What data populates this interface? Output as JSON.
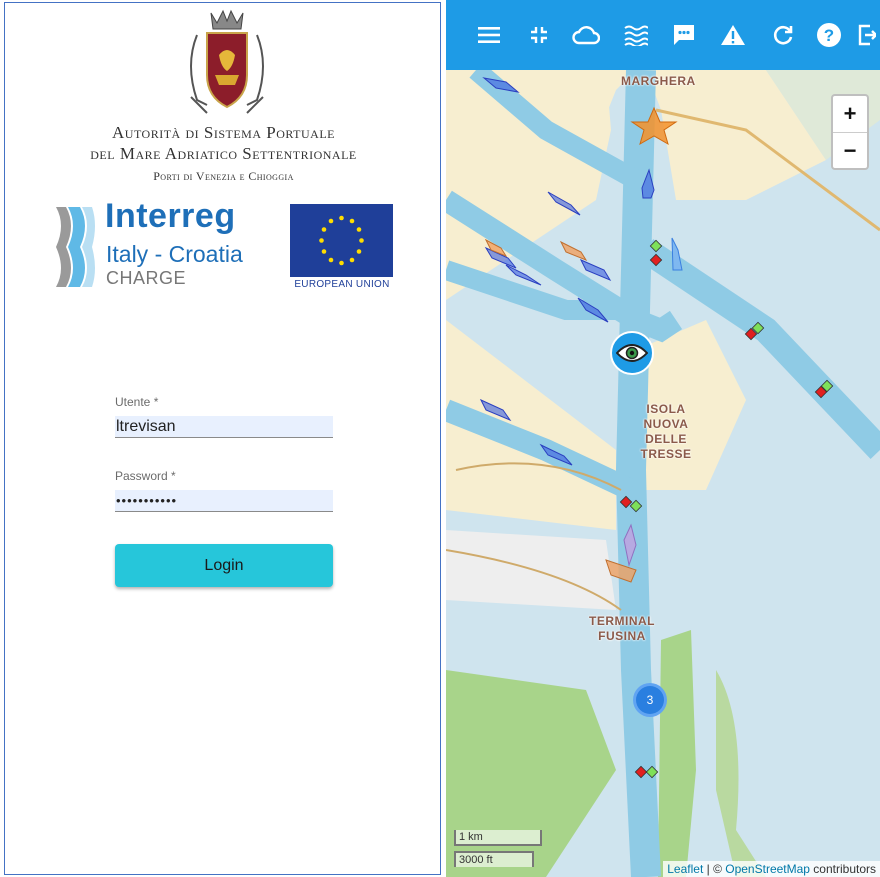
{
  "login": {
    "org_line1": "Autorità di Sistema Portuale",
    "org_line2": "del Mare Adriatico Settentrionale",
    "org_line3": "Porti di Venezia e Chioggia",
    "interreg_title": "Interreg",
    "interreg_subtitle": "Italy - Croatia",
    "interreg_charge": "CHARGE",
    "eu_label": "EUROPEAN UNION",
    "user_label": "Utente *",
    "user_value": "ltrevisan",
    "password_label": "Password *",
    "password_value": "•••••••••••",
    "login_button": "Login"
  },
  "toolbar": {
    "icons": [
      "menu-icon",
      "compress-icon",
      "cloud-icon",
      "waves-icon",
      "message-icon",
      "warning-icon",
      "refresh-icon",
      "help-icon",
      "logout-icon"
    ],
    "color": "#1e9be6"
  },
  "map": {
    "places": {
      "marghera": "MARGHERA",
      "isola_line1": "ISOLA NUOVA",
      "isola_line2": "DELLE TRESSE",
      "fusina_line1": "TERMINAL",
      "fusina_line2": "FUSINA"
    },
    "zoom_in": "+",
    "zoom_out": "−",
    "cluster_count": "3",
    "scale_metric": "1 km",
    "scale_imperial": "3000 ft",
    "attribution": {
      "leaflet": "Leaflet",
      "separator": " | © ",
      "osm": "OpenStreetMap",
      "contributors": " contributors"
    },
    "colors": {
      "water": "#cfe4ee",
      "channel": "#8fcbe5",
      "land": "#f7eed0",
      "green": "#a8d48a",
      "vessel": "#3a5fe0"
    }
  }
}
